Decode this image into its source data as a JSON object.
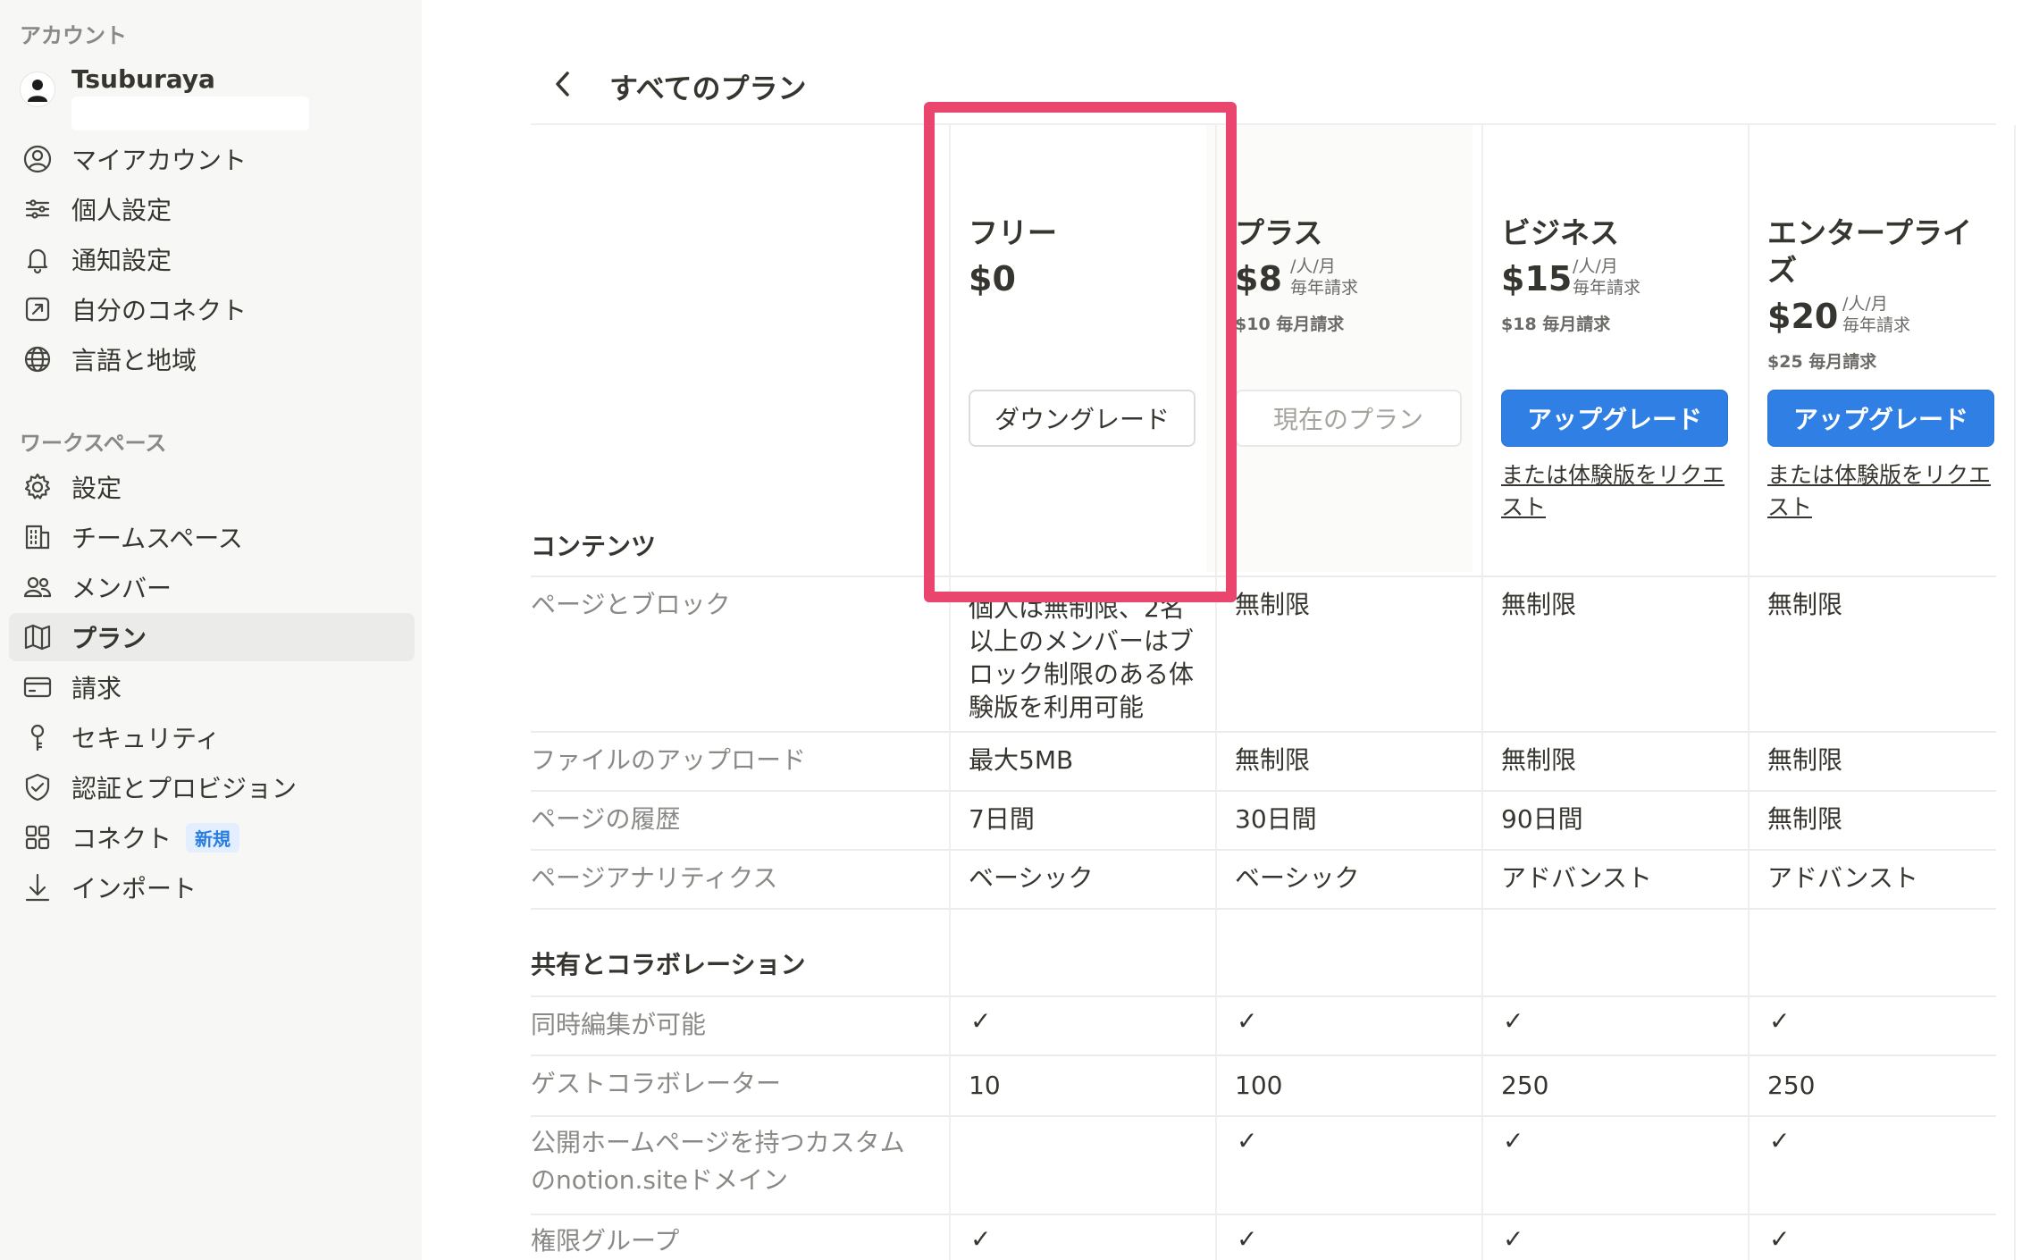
{
  "sidebar": {
    "account_section": "アカウント",
    "user_name": "Tsuburaya",
    "account_items": [
      {
        "label": "マイアカウント",
        "icon": "account-circle-icon"
      },
      {
        "label": "個人設定",
        "icon": "sliders-icon"
      },
      {
        "label": "通知設定",
        "icon": "bell-icon"
      },
      {
        "label": "自分のコネクト",
        "icon": "external-link-icon"
      },
      {
        "label": "言語と地域",
        "icon": "globe-icon"
      }
    ],
    "workspace_section": "ワークスペース",
    "workspace_items": [
      {
        "label": "設定",
        "icon": "gear-icon"
      },
      {
        "label": "チームスペース",
        "icon": "building-icon"
      },
      {
        "label": "メンバー",
        "icon": "people-icon"
      },
      {
        "label": "プラン",
        "icon": "map-icon"
      },
      {
        "label": "請求",
        "icon": "credit-card-icon"
      },
      {
        "label": "セキュリティ",
        "icon": "key-icon"
      },
      {
        "label": "認証とプロビジョン",
        "icon": "shield-check-icon"
      },
      {
        "label": "コネクト",
        "icon": "grid-icon",
        "badge": "新規"
      },
      {
        "label": "インポート",
        "icon": "download-icon"
      }
    ]
  },
  "header": {
    "title": "すべてのプラン"
  },
  "plans": [
    {
      "name": "フリー",
      "price": "$0",
      "per": "",
      "billing": "",
      "monthly": "",
      "button": "ダウングレード",
      "trial": ""
    },
    {
      "name": "プラス",
      "price": "$8",
      "per": "/人/月",
      "billing": "毎年請求",
      "monthly": "$10 毎月請求",
      "button": "現在のプラン",
      "trial": ""
    },
    {
      "name": "ビジネス",
      "price": "$15",
      "per": "/人/月",
      "billing": "毎年請求",
      "monthly": "$18 毎月請求",
      "button": "アップグレード",
      "trial": "または体験版をリクエスト"
    },
    {
      "name": "エンタープライズ",
      "price": "$20",
      "per": "/人/月",
      "billing": "毎年請求",
      "monthly": "$25 毎月請求",
      "button": "アップグレード",
      "trial": "または体験版をリクエスト"
    }
  ],
  "sections": {
    "content": "コンテンツ",
    "sharing": "共有とコラボレーション"
  },
  "content_rows": [
    {
      "feature": "ページとブロック",
      "values": [
        "個人は無制限、2名以上のメンバーはブロック制限のある体験版を利用可能",
        "無制限",
        "無制限",
        "無制限"
      ]
    },
    {
      "feature": "ファイルのアップロード",
      "values": [
        "最大5MB",
        "無制限",
        "無制限",
        "無制限"
      ]
    },
    {
      "feature": "ページの履歴",
      "values": [
        "7日間",
        "30日間",
        "90日間",
        "無制限"
      ]
    },
    {
      "feature": "ページアナリティクス",
      "values": [
        "ベーシック",
        "ベーシック",
        "アドバンスト",
        "アドバンスト"
      ]
    }
  ],
  "sharing_rows": [
    {
      "feature": "同時編集が可能",
      "values": [
        "✓",
        "✓",
        "✓",
        "✓"
      ]
    },
    {
      "feature": "ゲストコラボレーター",
      "values": [
        "10",
        "100",
        "250",
        "250"
      ]
    },
    {
      "feature": "公開ホームページを持つカスタムのnotion.siteドメイン",
      "values": [
        "",
        "✓",
        "✓",
        "✓"
      ]
    },
    {
      "feature": "権限グループ",
      "values": [
        "✓",
        "✓",
        "✓",
        "✓"
      ]
    }
  ],
  "colors": {
    "highlight": "#e9456d",
    "primary": "#2f7fe4",
    "sidebar_bg": "#f7f7f5"
  }
}
